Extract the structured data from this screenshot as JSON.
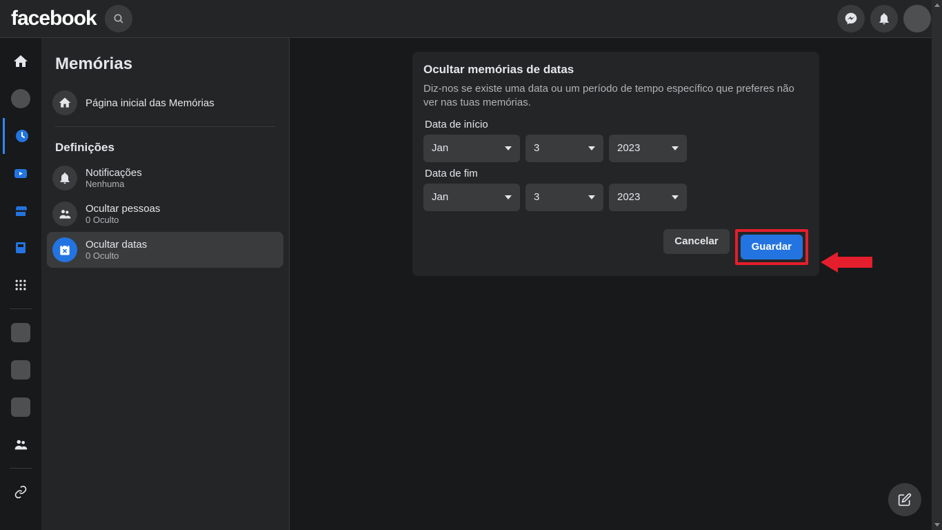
{
  "app": {
    "logo_text": "facebook"
  },
  "sidebar": {
    "title": "Memórias",
    "home_label": "Página inicial das Memórias",
    "section_title": "Definições",
    "items": [
      {
        "label": "Notificações",
        "sub": "Nenhuma"
      },
      {
        "label": "Ocultar pessoas",
        "sub": "0 Oculto"
      },
      {
        "label": "Ocultar datas",
        "sub": "0 Oculto"
      }
    ]
  },
  "card": {
    "title": "Ocultar memórias de datas",
    "description": "Diz-nos se existe uma data ou um período de tempo específico que preferes não ver nas tuas memórias.",
    "start_label": "Data de início",
    "end_label": "Data de fim",
    "start": {
      "month": "Jan",
      "day": "3",
      "year": "2023"
    },
    "end": {
      "month": "Jan",
      "day": "3",
      "year": "2023"
    },
    "cancel_label": "Cancelar",
    "save_label": "Guardar"
  }
}
